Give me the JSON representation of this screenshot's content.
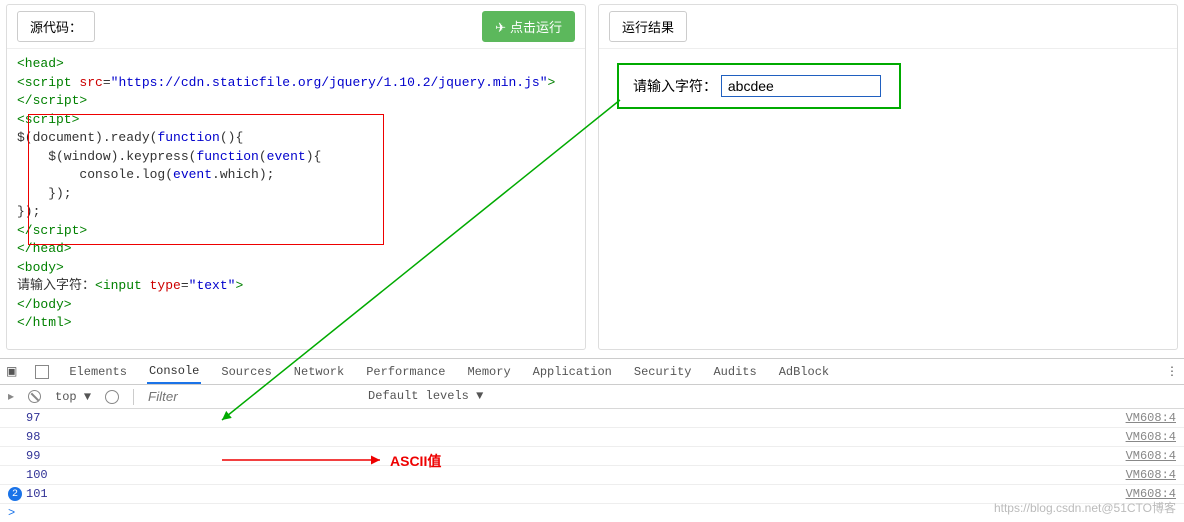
{
  "left_panel": {
    "title_label": "源代码：",
    "run_button": "点击运行",
    "code_tokens": [
      {
        "cls": "t-green",
        "txt": "<head>\n"
      },
      {
        "cls": "t-green",
        "txt": "<script "
      },
      {
        "cls": "t-red",
        "txt": "src"
      },
      {
        "cls": "",
        "txt": "="
      },
      {
        "cls": "t-blue",
        "txt": "\"https://cdn.staticfile.org/jquery/1.10.2/jquery.min.js\""
      },
      {
        "cls": "t-green",
        "txt": ">\n</"
      },
      {
        "cls": "t-green",
        "txt": "script>\n"
      },
      {
        "cls": "t-green",
        "txt": "<script>\n"
      },
      {
        "cls": "",
        "txt": "$(document).ready("
      },
      {
        "cls": "t-blue",
        "txt": "function"
      },
      {
        "cls": "",
        "txt": "(){\n    $(window).keypress("
      },
      {
        "cls": "t-blue",
        "txt": "function"
      },
      {
        "cls": "",
        "txt": "("
      },
      {
        "cls": "t-blue",
        "txt": "event"
      },
      {
        "cls": "",
        "txt": "){\n        console.log("
      },
      {
        "cls": "t-blue",
        "txt": "event"
      },
      {
        "cls": "",
        "txt": ".which);\n    });\n});\n"
      },
      {
        "cls": "t-green",
        "txt": "</"
      },
      {
        "cls": "t-green",
        "txt": "script>\n"
      },
      {
        "cls": "t-green",
        "txt": "</head>\n"
      },
      {
        "cls": "t-green",
        "txt": "<body>\n"
      },
      {
        "cls": "",
        "txt": "请输入字符："
      },
      {
        "cls": "t-green",
        "txt": "<input "
      },
      {
        "cls": "t-red",
        "txt": "type"
      },
      {
        "cls": "",
        "txt": "="
      },
      {
        "cls": "t-blue",
        "txt": "\"text\""
      },
      {
        "cls": "t-green",
        "txt": ">\n"
      },
      {
        "cls": "t-green",
        "txt": "</body>\n"
      },
      {
        "cls": "t-green",
        "txt": "</html>"
      }
    ]
  },
  "right_panel": {
    "title_label": "运行结果",
    "prompt_label": "请输入字符：",
    "input_value": "abcdee"
  },
  "devtools": {
    "tabs": [
      "Elements",
      "Console",
      "Sources",
      "Network",
      "Performance",
      "Memory",
      "Application",
      "Security",
      "Audits",
      "AdBlock"
    ],
    "active_tab": "Console",
    "context": "top",
    "filter_placeholder": "Filter",
    "levels_label": "Default levels ▼",
    "rows": [
      {
        "value": "97",
        "badge": null,
        "src": "VM608:4"
      },
      {
        "value": "98",
        "badge": null,
        "src": "VM608:4"
      },
      {
        "value": "99",
        "badge": null,
        "src": "VM608:4"
      },
      {
        "value": "100",
        "badge": null,
        "src": "VM608:4"
      },
      {
        "value": "101",
        "badge": "2",
        "src": "VM608:4"
      }
    ],
    "prompt": ">"
  },
  "annotations": {
    "ascii_label": "ASCII值",
    "watermark": "https://blog.csdn.net@51CTO博客"
  }
}
